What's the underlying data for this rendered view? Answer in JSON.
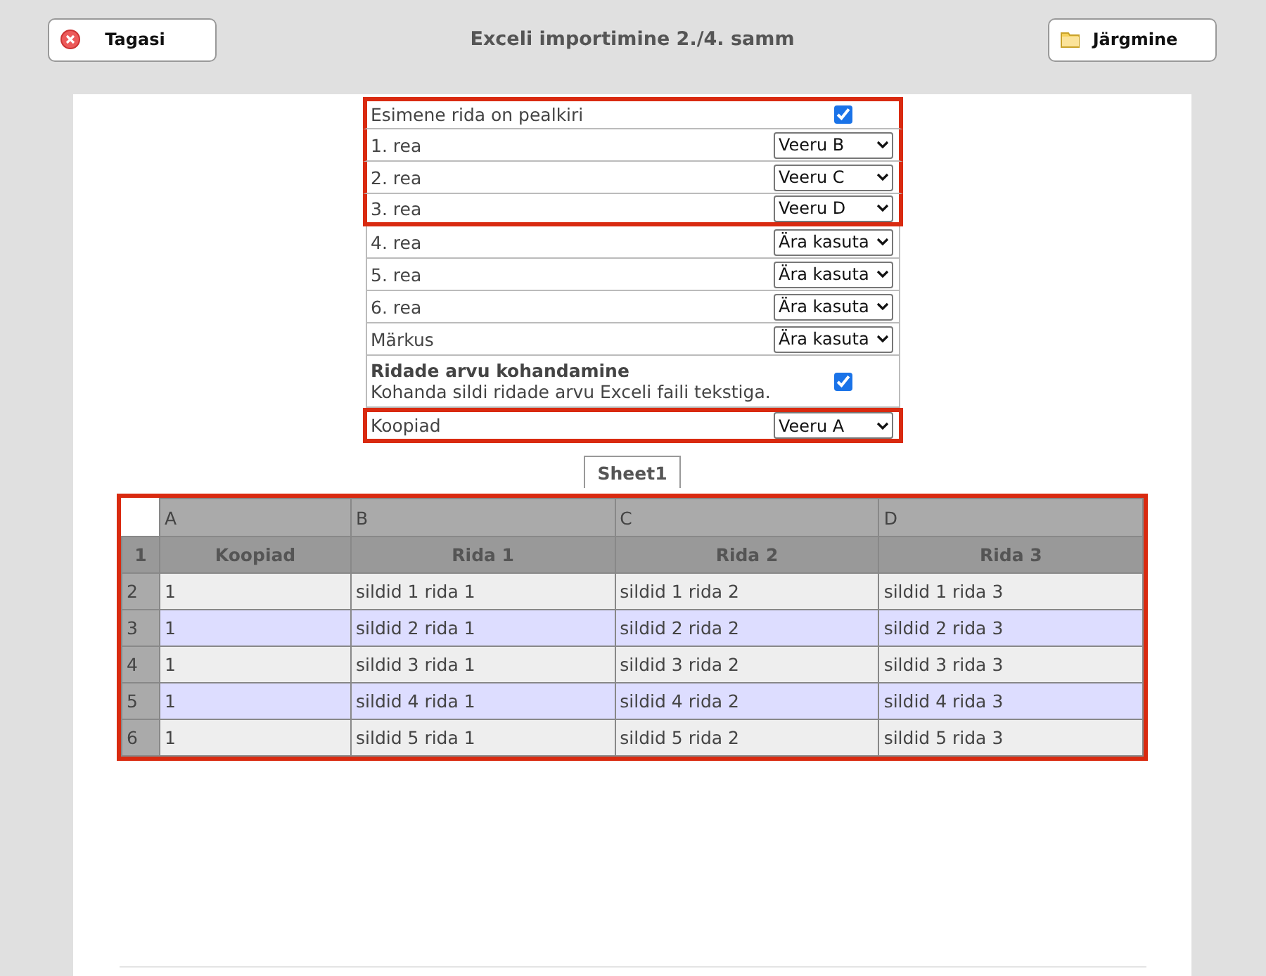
{
  "header": {
    "back_button": "Tagasi",
    "title": "Exceli importimine 2./4. samm",
    "next_button": "Järgmine"
  },
  "mapping": [
    {
      "kind": "checkbox",
      "label": "Esimene rida on pealkiri",
      "checked": true,
      "highlighted": true
    },
    {
      "kind": "select",
      "label": "1. rea",
      "value": "Veeru B",
      "highlighted": true
    },
    {
      "kind": "select",
      "label": "2. rea",
      "value": "Veeru C",
      "highlighted": true
    },
    {
      "kind": "select",
      "label": "3. rea",
      "value": "Veeru D",
      "highlighted": true
    },
    {
      "kind": "select",
      "label": "4. rea",
      "value": "Ära kasuta",
      "highlighted": false
    },
    {
      "kind": "select",
      "label": "5. rea",
      "value": "Ära kasuta",
      "highlighted": false
    },
    {
      "kind": "select",
      "label": "6. rea",
      "value": "Ära kasuta",
      "highlighted": false
    },
    {
      "kind": "select",
      "label": "Märkus",
      "value": "Ära kasuta",
      "highlighted": false
    },
    {
      "kind": "checkbox_note",
      "title": "Ridade arvu kohandamine",
      "description": "Kohanda sildi ridade arvu Exceli faili tekstiga.",
      "checked": true,
      "highlighted": false
    },
    {
      "kind": "select",
      "label": "Koopiad",
      "value": "Veeru A",
      "highlighted": true
    }
  ],
  "sheet_tabs": [
    {
      "label": "Sheet1",
      "selected": true
    }
  ],
  "sheet": {
    "highlighted": true,
    "column_letters": [
      "A",
      "B",
      "C",
      "D"
    ],
    "rows": [
      {
        "kind": "header",
        "number": "1",
        "cells": [
          "Koopiad",
          "Rida 1",
          "Rida 2",
          "Rida 3"
        ]
      },
      {
        "kind": "data",
        "number": "2",
        "cells": [
          "1",
          "sildid 1 rida 1",
          "sildid 1 rida 2",
          "sildid 1 rida 3"
        ]
      },
      {
        "kind": "data",
        "number": "3",
        "cells": [
          "1",
          "sildid 2 rida 1",
          "sildid 2 rida 2",
          "sildid 2 rida 3"
        ]
      },
      {
        "kind": "data",
        "number": "4",
        "cells": [
          "1",
          "sildid 3 rida 1",
          "sildid 3 rida 2",
          "sildid 3 rida 3"
        ]
      },
      {
        "kind": "data",
        "number": "5",
        "cells": [
          "1",
          "sildid 4 rida 1",
          "sildid 4 rida 2",
          "sildid 4 rida 3"
        ]
      },
      {
        "kind": "data",
        "number": "6",
        "cells": [
          "1",
          "sildid 5 rida 1",
          "sildid 5 rida 2",
          "sildid 5 rida 3"
        ]
      }
    ]
  }
}
